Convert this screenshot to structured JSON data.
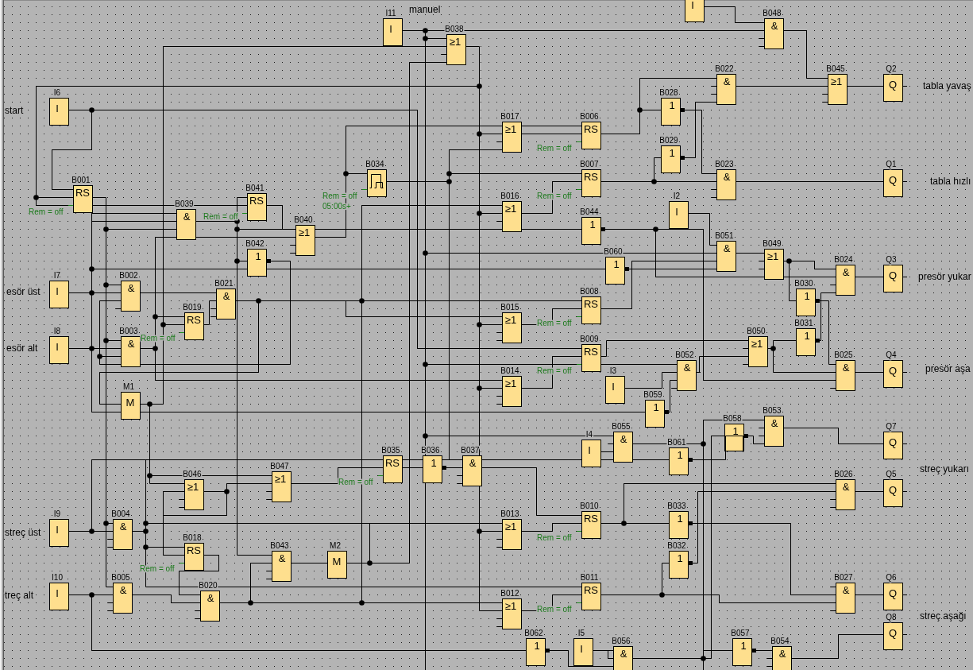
{
  "diagram": {
    "signal_labels": [
      "manuel",
      "tabla yavaş",
      "start",
      "tabla hızlı",
      "presör yukar",
      "esör üst",
      "esör alt",
      "presör aşa",
      "streç yukarı",
      "streç üst",
      "treç alt",
      "streç aşağı"
    ],
    "parameters": [
      "Rem = off",
      "Rem = off",
      "Rem = off",
      "05:00s+",
      "Rem = off",
      "Rem = off",
      "Rem = off",
      "Rem = off",
      "Rem = off",
      "Rem = off",
      "Rem = off",
      "Rem = off",
      "Rem = off"
    ],
    "blocks": [
      {
        "kind": "input",
        "symbol": "I"
      },
      {
        "label": "I11",
        "kind": "input",
        "symbol": "I"
      },
      {
        "label": "B038",
        "kind": "or",
        "symbol": "≥1"
      },
      {
        "label": "B048",
        "kind": "and",
        "symbol": "&"
      },
      {
        "label": "B022",
        "kind": "and",
        "symbol": "&"
      },
      {
        "label": "B045",
        "kind": "or",
        "symbol": "≥1"
      },
      {
        "label": "Q2",
        "kind": "output",
        "symbol": "Q"
      },
      {
        "label": "I6",
        "kind": "input",
        "symbol": "I"
      },
      {
        "label": "B028",
        "kind": "not",
        "symbol": "1"
      },
      {
        "label": "B017",
        "kind": "or",
        "symbol": "≥1"
      },
      {
        "label": "B006",
        "kind": "rs",
        "symbol": "RS"
      },
      {
        "label": "B029",
        "kind": "not",
        "symbol": "1"
      },
      {
        "label": "B034",
        "kind": "pulse"
      },
      {
        "label": "B007",
        "kind": "rs",
        "symbol": "RS"
      },
      {
        "label": "B023",
        "kind": "and",
        "symbol": "&"
      },
      {
        "label": "Q1",
        "kind": "output",
        "symbol": "Q"
      },
      {
        "label": "B001",
        "kind": "rs",
        "symbol": "RS"
      },
      {
        "label": "B041",
        "kind": "rs",
        "symbol": "RS"
      },
      {
        "label": "B039",
        "kind": "and",
        "symbol": "&"
      },
      {
        "label": "B016",
        "kind": "or",
        "symbol": "≥1"
      },
      {
        "label": "I2",
        "kind": "input",
        "symbol": "I"
      },
      {
        "label": "B044",
        "kind": "not",
        "symbol": "1"
      },
      {
        "label": "B040",
        "kind": "or",
        "symbol": "≥1"
      },
      {
        "label": "B051",
        "kind": "and",
        "symbol": "&"
      },
      {
        "label": "B042",
        "kind": "not",
        "symbol": "1"
      },
      {
        "label": "B049",
        "kind": "or",
        "symbol": "≥1"
      },
      {
        "label": "B060",
        "kind": "not",
        "symbol": "1"
      },
      {
        "label": "B024",
        "kind": "and",
        "symbol": "&"
      },
      {
        "label": "Q3",
        "kind": "output",
        "symbol": "Q"
      },
      {
        "label": "I7",
        "kind": "input",
        "symbol": "I"
      },
      {
        "label": "B002",
        "kind": "and",
        "symbol": "&"
      },
      {
        "label": "B021",
        "kind": "and",
        "symbol": "&"
      },
      {
        "label": "B030",
        "kind": "not",
        "symbol": "1"
      },
      {
        "label": "B008",
        "kind": "rs",
        "symbol": "RS"
      },
      {
        "label": "B019",
        "kind": "rs",
        "symbol": "RS"
      },
      {
        "label": "B015",
        "kind": "or",
        "symbol": "≥1"
      },
      {
        "label": "B031",
        "kind": "not",
        "symbol": "1"
      },
      {
        "label": "I8",
        "kind": "input",
        "symbol": "I"
      },
      {
        "label": "B003",
        "kind": "and",
        "symbol": "&"
      },
      {
        "label": "B009",
        "kind": "rs",
        "symbol": "RS"
      },
      {
        "label": "B050",
        "kind": "or",
        "symbol": "≥1"
      },
      {
        "label": "B052",
        "kind": "and",
        "symbol": "&"
      },
      {
        "label": "B025",
        "kind": "and",
        "symbol": "&"
      },
      {
        "label": "Q4",
        "kind": "output",
        "symbol": "Q"
      },
      {
        "label": "B014",
        "kind": "or",
        "symbol": "≥1"
      },
      {
        "label": "I3",
        "kind": "input",
        "symbol": "I"
      },
      {
        "label": "M1",
        "kind": "flag",
        "symbol": "M"
      },
      {
        "label": "B059",
        "kind": "not",
        "symbol": "1"
      },
      {
        "label": "B053",
        "kind": "and",
        "symbol": "&"
      },
      {
        "label": "B058",
        "kind": "not",
        "symbol": "1"
      },
      {
        "label": "B055",
        "kind": "and",
        "symbol": "&"
      },
      {
        "label": "I4",
        "kind": "input",
        "symbol": "I"
      },
      {
        "label": "Q7",
        "kind": "output",
        "symbol": "Q"
      },
      {
        "label": "B061",
        "kind": "not",
        "symbol": "1"
      },
      {
        "label": "B035",
        "kind": "rs",
        "symbol": "RS"
      },
      {
        "label": "B036",
        "kind": "not",
        "symbol": "1"
      },
      {
        "label": "B037",
        "kind": "and",
        "symbol": "&"
      },
      {
        "label": "B047",
        "kind": "or",
        "symbol": "≥1"
      },
      {
        "label": "B046",
        "kind": "or",
        "symbol": "≥1"
      },
      {
        "label": "B026",
        "kind": "and",
        "symbol": "&"
      },
      {
        "label": "Q5",
        "kind": "output",
        "symbol": "Q"
      },
      {
        "label": "B010",
        "kind": "rs",
        "symbol": "RS"
      },
      {
        "label": "B033",
        "kind": "not",
        "symbol": "1"
      },
      {
        "label": "I9",
        "kind": "input",
        "symbol": "I"
      },
      {
        "label": "B004",
        "kind": "and",
        "symbol": "&"
      },
      {
        "label": "B013",
        "kind": "or",
        "symbol": "≥1"
      },
      {
        "label": "B018",
        "kind": "rs",
        "symbol": "RS"
      },
      {
        "label": "B043",
        "kind": "and",
        "symbol": "&"
      },
      {
        "label": "M2",
        "kind": "flag",
        "symbol": "M"
      },
      {
        "label": "B032",
        "kind": "not",
        "symbol": "1"
      },
      {
        "label": "I10",
        "kind": "input",
        "symbol": "I"
      },
      {
        "label": "B005",
        "kind": "and",
        "symbol": "&"
      },
      {
        "label": "B020",
        "kind": "and",
        "symbol": "&"
      },
      {
        "label": "B011",
        "kind": "rs",
        "symbol": "RS"
      },
      {
        "label": "B027",
        "kind": "and",
        "symbol": "&"
      },
      {
        "label": "Q6",
        "kind": "output",
        "symbol": "Q"
      },
      {
        "label": "B012",
        "kind": "or",
        "symbol": "≥1"
      },
      {
        "label": "Q8",
        "kind": "output",
        "symbol": "Q"
      },
      {
        "label": "B062",
        "kind": "not",
        "symbol": "1"
      },
      {
        "label": "I5",
        "kind": "input",
        "symbol": "I"
      },
      {
        "label": "B056",
        "kind": "and",
        "symbol": "&"
      },
      {
        "label": "B057",
        "kind": "not",
        "symbol": "1"
      },
      {
        "label": "B054",
        "kind": "and",
        "symbol": "&"
      }
    ]
  }
}
